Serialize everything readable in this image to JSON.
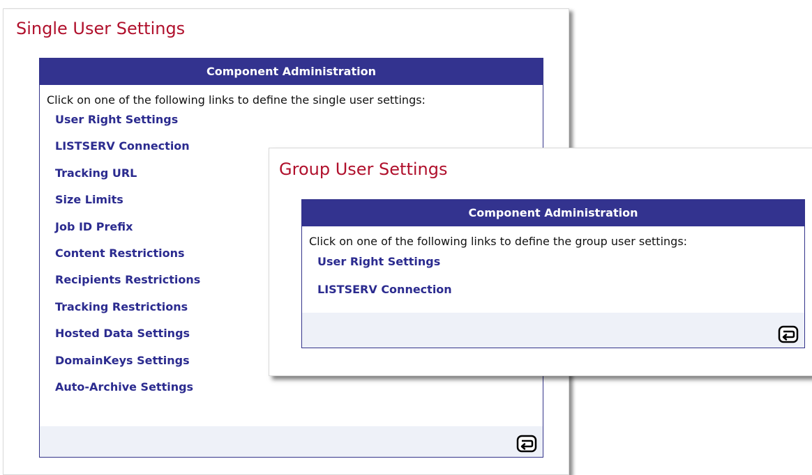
{
  "single": {
    "title": "Single User Settings",
    "header": "Component Administration",
    "instruction": "Click on one of the following links to define the single user settings:",
    "links": [
      "User Right Settings",
      "LISTSERV Connection",
      "Tracking URL",
      "Size Limits",
      "Job ID Prefix",
      "Content Restrictions",
      "Recipients Restrictions",
      "Tracking Restrictions",
      "Hosted Data Settings",
      "DomainKeys Settings",
      "Auto-Archive Settings"
    ],
    "back_icon": "return-arrow-icon"
  },
  "group": {
    "title": "Group User Settings",
    "header": "Component Administration",
    "instruction": "Click on one of the following links to define the group user settings:",
    "links": [
      "User Right Settings",
      "LISTSERV Connection"
    ],
    "back_icon": "return-arrow-icon"
  },
  "colors": {
    "title_red": "#b0102c",
    "header_navy": "#33338f",
    "link_blue": "#2b2b8f",
    "footer_bg": "#eef1f8"
  }
}
